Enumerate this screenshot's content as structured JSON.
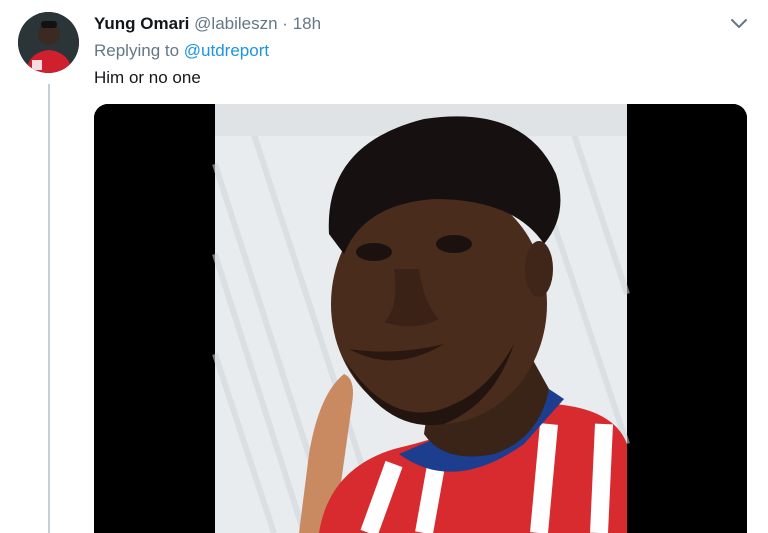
{
  "tweet": {
    "author_name": "Yung Omari",
    "author_handle": "@labileszn",
    "separator": "·",
    "timestamp": "18h",
    "replying_prefix": "Replying to",
    "replying_to": "@utdreport",
    "text": "Him or no one"
  },
  "icons": {
    "caret": "chevron-down-icon",
    "avatar": "profile-avatar"
  },
  "media": {
    "type": "video-frame",
    "description_icon": "video-thumbnail"
  },
  "colors": {
    "link": "#1b95e0",
    "secondary_text": "#657786",
    "primary_text": "#14171a",
    "thread_line": "#c4cfd6"
  }
}
